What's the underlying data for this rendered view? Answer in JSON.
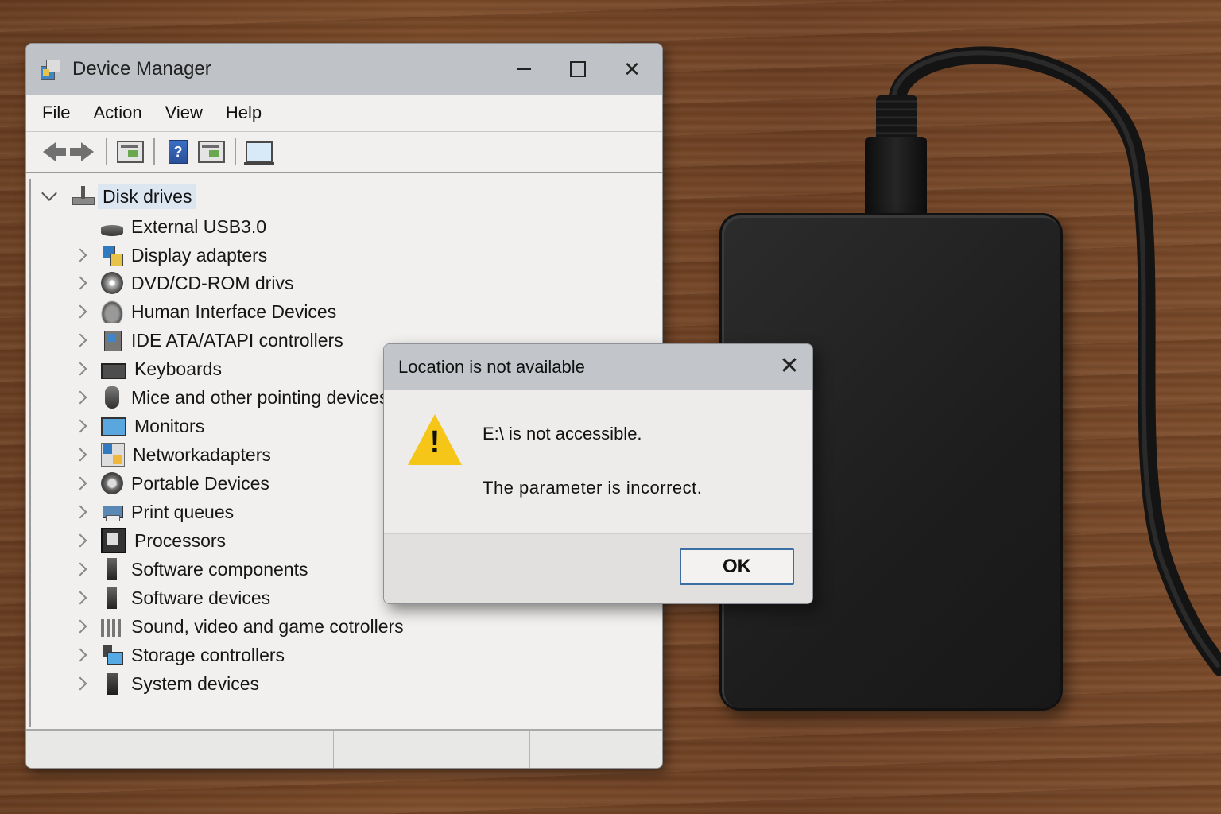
{
  "device_manager": {
    "title": "Device Manager",
    "menu": [
      "File",
      "Action",
      "View",
      "Help"
    ],
    "toolbar": [
      "back-arrow-icon",
      "forward-arrow-icon",
      "properties-icon",
      "help-icon",
      "update-driver-icon",
      "scan-hardware-icon"
    ],
    "tree": {
      "root": "Disk drives",
      "expanded_child": "External USB3.0",
      "items": [
        "Display adapters",
        "DVD/CD-ROM drivs",
        "Human Interface Devices",
        "IDE ATA/ATAPI controllers",
        "Keyboards",
        "Mice and other pointing devices",
        "Monitors",
        "Networkadapters",
        "Portable Devices",
        "Print queues",
        "Processors",
        "Software components",
        "Software devices",
        "Sound, video and game cotrollers",
        "Storage controllers",
        "System devices"
      ]
    }
  },
  "dialog": {
    "title": "Location is not available",
    "message_line1": "E:\\ is not accessible.",
    "message_line2": "The parameter is incorrect.",
    "ok_label": "OK",
    "icon": "warning-icon"
  },
  "colors": {
    "accent": "#3a6ea5",
    "warning": "#f5c518",
    "titlebar": "#bfc3c8",
    "desk": "#6e4124",
    "drive": "#1f1f1f"
  }
}
